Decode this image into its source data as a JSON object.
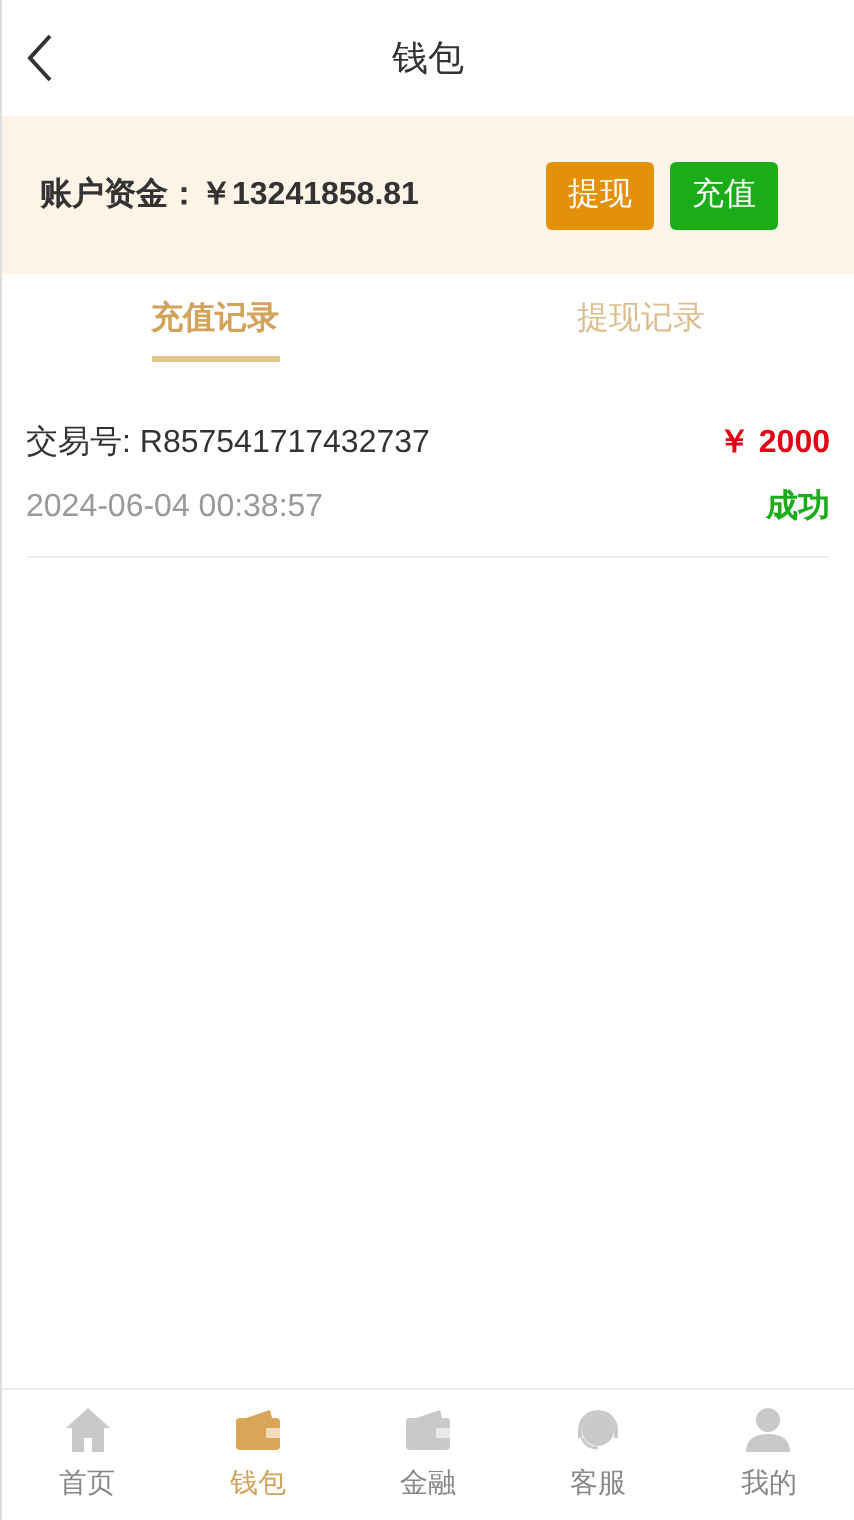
{
  "header": {
    "title": "钱包"
  },
  "account": {
    "label": "账户资金：",
    "balance": "￥13241858.81",
    "buttons": [
      {
        "label": "提现",
        "kind": "withdraw"
      },
      {
        "label": "充值",
        "kind": "deposit"
      }
    ]
  },
  "tabs": [
    {
      "label": "充值记录",
      "selected": true
    },
    {
      "label": "提现记录",
      "selected": false
    }
  ],
  "records": [
    {
      "transaction_id": "交易号: R857541717432737",
      "amount": "￥ 2000",
      "time": "2024-06-04 00:38:57",
      "status": "成功"
    }
  ],
  "bottom_nav": [
    {
      "label": "首页",
      "selected": false
    },
    {
      "label": "钱包",
      "selected": true
    },
    {
      "label": "金融",
      "selected": false
    },
    {
      "label": "客服",
      "selected": false
    },
    {
      "label": "我的",
      "selected": false
    }
  ]
}
